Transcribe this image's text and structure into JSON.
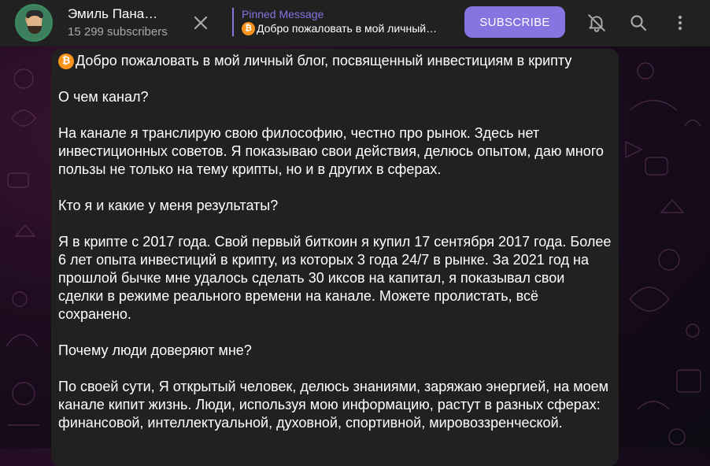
{
  "header": {
    "channel_name": "Эмиль Пана…",
    "subscribers": "15 299 subscribers",
    "pinned_label": "Pinned Message",
    "pinned_text": "Добро пожаловать в мой личный…",
    "subscribe_label": "SUBSCRIBE"
  },
  "icons": {
    "close": "close-icon",
    "mute": "bell-off-icon",
    "search": "search-icon",
    "menu": "more-vertical-icon",
    "bitcoin": "bitcoin-icon"
  },
  "colors": {
    "accent": "#8774e1",
    "header_bg": "#212121",
    "bubble_bg": "#212121",
    "bitcoin": "#f7931a"
  },
  "message": {
    "line1": "Добро пожаловать в мой личный блог, посвященный инвестициям в крипту",
    "p2": "О чем канал?",
    "p3": "На канале я транслирую свою философию, честно про рынок. Здесь нет инвестиционных советов. Я показываю свои действия, делюсь опытом, даю много пользы не только на тему крипты, но и в других в сферах.",
    "p4": "Кто я и какие у меня результаты?",
    "p5": "Я в крипте с 2017 года. Свой первый биткоин я купил 17 сентября 2017 года. Более 6 лет опыта инвестиций в крипту, из которых 3 года 24/7 в рынке. За 2021 год на прошлой бычке мне удалось сделать 30 иксов на капитал, я показывал свои сделки в режиме реального времени на канале. Можете пролистать, всё сохранено.",
    "p6": "Почему люди доверяют мне?",
    "p7": "По своей сути, Я открытый человек, делюсь знаниями, заряжаю энергией, на моем канале кипит жизнь. Люди, используя мою информацию, растут в разных сферах: финансовой, интеллектуальной, духовной, спортивной, мировоззренческой."
  }
}
